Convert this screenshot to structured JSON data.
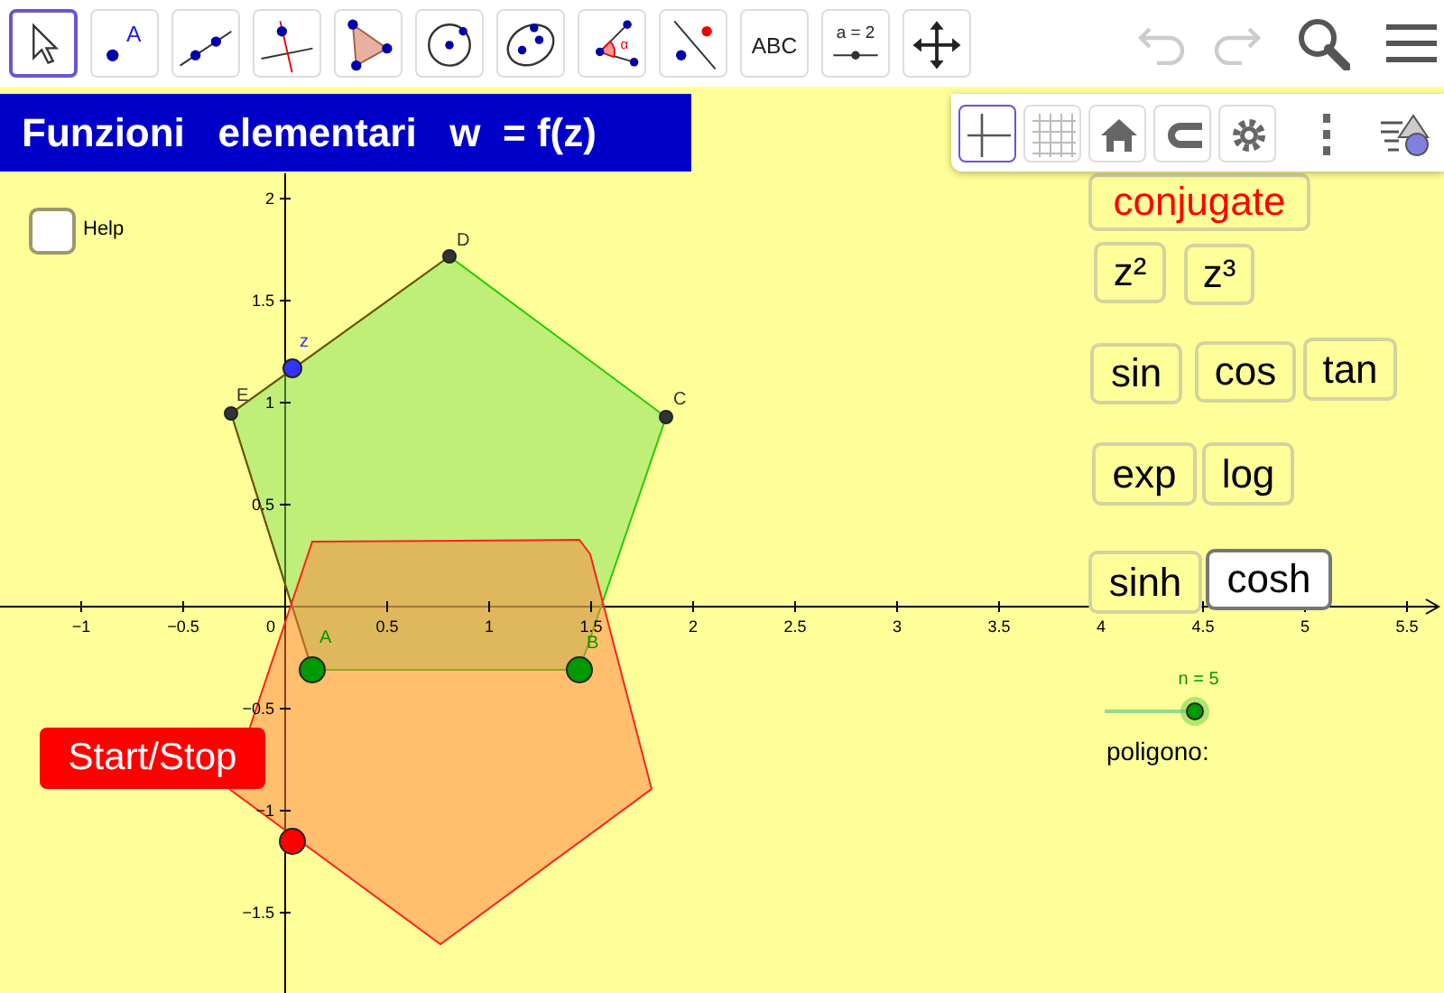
{
  "toolbar": {
    "tools": [
      {
        "kind": "move",
        "selected": true
      },
      {
        "kind": "point",
        "label": "A",
        "selected": false
      },
      {
        "kind": "line",
        "selected": false
      },
      {
        "kind": "perpendicular",
        "selected": false
      },
      {
        "kind": "polygon",
        "selected": false
      },
      {
        "kind": "circle",
        "selected": false
      },
      {
        "kind": "ellipse",
        "selected": false
      },
      {
        "kind": "angle",
        "label": "α",
        "selected": false
      },
      {
        "kind": "reflect",
        "selected": false
      },
      {
        "kind": "text",
        "label": "ABC",
        "selected": false
      },
      {
        "kind": "slider",
        "label": "a = 2",
        "selected": false
      },
      {
        "kind": "pan",
        "selected": false
      }
    ],
    "history": [
      {
        "kind": "undo",
        "disabled": true
      },
      {
        "kind": "redo",
        "disabled": true
      }
    ],
    "actions": [
      {
        "kind": "search"
      },
      {
        "kind": "menu"
      }
    ]
  },
  "title_bar": {
    "title": "Funzioni   elementari   w  = f(z)"
  },
  "style_bar": [
    {
      "kind": "axes",
      "selected": true
    },
    {
      "kind": "grid",
      "selected": false
    },
    {
      "kind": "home",
      "selected": false
    },
    {
      "kind": "snap",
      "selected": false
    },
    {
      "kind": "settings",
      "selected": false
    },
    {
      "kind": "more"
    },
    {
      "kind": "view"
    }
  ],
  "graphics": {
    "x_ticks": [
      "−1",
      "−0.5",
      "0",
      "0.5",
      "1",
      "1.5",
      "2",
      "2.5",
      "3",
      "3.5",
      "4",
      "4.5",
      "5",
      "5.5"
    ],
    "y_ticks": [
      "2",
      "1.5",
      "1",
      "0.5",
      "−0.5",
      "−1",
      "−1.5"
    ],
    "points": [
      {
        "label": "D",
        "color": "#333333"
      },
      {
        "label": "C",
        "color": "#333333"
      },
      {
        "label": "E",
        "color": "#333333"
      },
      {
        "label": "z",
        "color": "#3333ff"
      },
      {
        "label": "A",
        "color": "#009900"
      },
      {
        "label": "B",
        "color": "#009900"
      },
      {
        "color": "#ff0000"
      }
    ],
    "help": {
      "label": "Help",
      "checked": false
    },
    "start_button": {
      "label": "Start/Stop"
    },
    "function_buttons": [
      {
        "label": "conjugate",
        "color": "#ff0000",
        "selected": false
      },
      {
        "label": "z²",
        "color": "#000000",
        "selected": false
      },
      {
        "label": "z³",
        "color": "#000000",
        "selected": false
      },
      {
        "label": "sin",
        "color": "#000000",
        "selected": false
      },
      {
        "label": "cos",
        "color": "#000000",
        "selected": false
      },
      {
        "label": "tan",
        "color": "#000000",
        "selected": false
      },
      {
        "label": "exp",
        "color": "#000000",
        "selected": false
      },
      {
        "label": "log",
        "color": "#000000",
        "selected": false
      },
      {
        "label": "sinh",
        "color": "#000000",
        "selected": false
      },
      {
        "label": "cosh",
        "color": "#000000",
        "selected": true
      }
    ],
    "slider": {
      "label": "n = 5",
      "level": 1
    },
    "polygon_label": "poligono:"
  }
}
